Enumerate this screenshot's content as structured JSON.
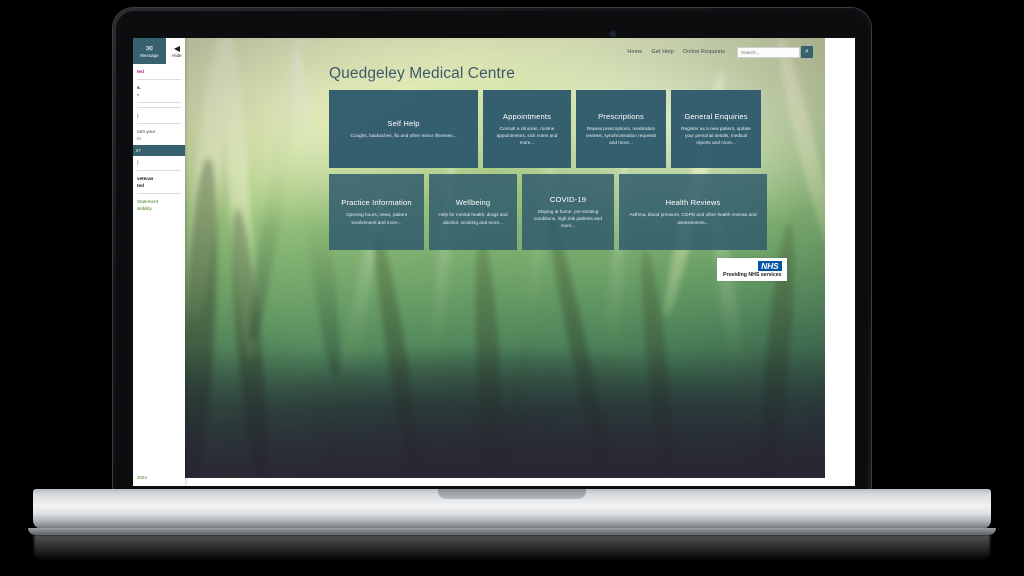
{
  "device": {
    "type": "laptop-mockup",
    "webcam": "webcam-dot"
  },
  "sidebar": {
    "message_button": {
      "label": "Message",
      "icon": "envelope-icon"
    },
    "hide_button": {
      "label": "Hide",
      "icon": "speaker-icon"
    },
    "clipped_lines": [
      "ted",
      "s.",
      "e",
      ")",
      "rom your",
      "m"
    ],
    "highlight_line": "s?",
    "lower_lines": [
      "veteran",
      "ted"
    ],
    "link_lines": [
      "Statement",
      "ssibility"
    ],
    "footer": "2023"
  },
  "nav": {
    "links": [
      {
        "label": "Home"
      },
      {
        "label": "Get Help"
      },
      {
        "label": "Online Requests"
      }
    ],
    "search": {
      "placeholder": "Search...",
      "value": "",
      "button_icon": "search-icon",
      "button_glyph": "⌕"
    }
  },
  "header": {
    "title": "Quedgeley Medical Centre"
  },
  "tiles_row1": [
    {
      "title": "Self Help",
      "desc": "Coughs, backaches, flu and other minor illnesses...",
      "key": "self-help"
    },
    {
      "title": "Appointments",
      "desc": "Consult a clinician, routine appointments, sick notes and more...",
      "key": "appointments"
    },
    {
      "title": "Prescriptions",
      "desc": "Repeat prescriptions, medication reviews, synchronisation requests and more...",
      "key": "prescriptions"
    },
    {
      "title": "General Enquiries",
      "desc": "Register as a new patient, update your personal details, medical reports and more...",
      "key": "general-enquiries"
    }
  ],
  "tiles_row2": [
    {
      "title": "Practice Information",
      "desc": "Opening hours, news, patient involvement and more...",
      "key": "practice-information"
    },
    {
      "title": "Wellbeing",
      "desc": "Help for mental health, drugs and alcohol, smoking and more...",
      "key": "wellbeing"
    },
    {
      "title": "COVID-19",
      "desc": "Staying at home, pre-existing conditions, high risk patients and more...",
      "key": "covid-19"
    },
    {
      "title": "Health Reviews",
      "desc": "Asthma, blood pressure, COPD and other health reviews and assessments...",
      "key": "health-reviews"
    }
  ],
  "nhs_badge": {
    "logo_text": "NHS",
    "tagline": "Providing NHS services"
  },
  "colors": {
    "tile": "#2e596c",
    "brand_teal": "#37616f",
    "title_blue": "#3f586b",
    "nhs_blue": "#0055a4",
    "nav_text": "#3c4a52"
  }
}
